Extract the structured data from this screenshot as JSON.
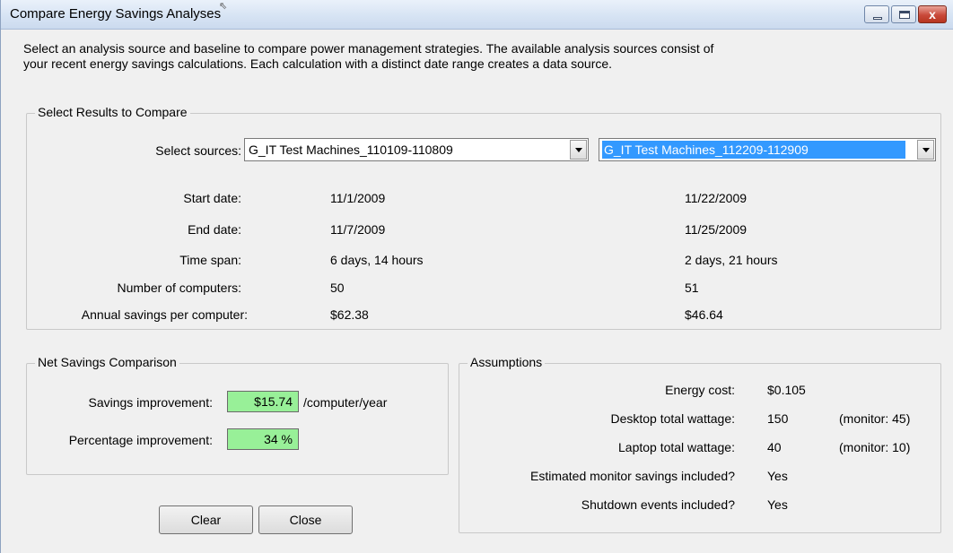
{
  "window": {
    "title": "Compare Energy Savings Analyses",
    "close_glyph": "x",
    "icons": [
      "minimize-icon",
      "maximize-icon",
      "close-icon"
    ]
  },
  "intro": {
    "line1": "Select an analysis source and baseline to compare power management strategies.  The available analysis sources consist of",
    "line2": "your recent energy savings calculations. Each calculation with a distinct date range creates a data source."
  },
  "results": {
    "legend": "Select Results to Compare",
    "select_label": "Select sources:",
    "source1": "G_IT Test Machines_110109-110809",
    "source2": "G_IT Test Machines_112209-112909",
    "rows": [
      {
        "label": "Start date:",
        "v1": "11/1/2009",
        "v2": "11/22/2009"
      },
      {
        "label": "End date:",
        "v1": "11/7/2009",
        "v2": "11/25/2009"
      },
      {
        "label": "Time span:",
        "v1": "6 days, 14 hours",
        "v2": "2 days, 21 hours"
      },
      {
        "label": "Number of computers:",
        "v1": "50",
        "v2": "51"
      },
      {
        "label": "Annual savings per computer:",
        "v1": "$62.38",
        "v2": "$46.64"
      }
    ]
  },
  "net": {
    "legend": "Net Savings Comparison",
    "savings_label": "Savings  improvement:",
    "savings_value": "$15.74",
    "savings_unit": "/computer/year",
    "pct_label": "Percentage improvement:",
    "pct_value": "34 %"
  },
  "buttons": {
    "clear": "Clear",
    "close": "Close"
  },
  "assumptions": {
    "legend": "Assumptions",
    "rows": [
      {
        "label": "Energy cost:",
        "value": "$0.105",
        "extra": ""
      },
      {
        "label": "Desktop total wattage:",
        "value": "150",
        "extra": "(monitor: 45)"
      },
      {
        "label": "Laptop total wattage:",
        "value": "40",
        "extra": "(monitor: 10)"
      },
      {
        "label": "Estimated monitor savings included?",
        "value": "Yes",
        "extra": ""
      },
      {
        "label": "Shutdown events included?",
        "value": "Yes",
        "extra": ""
      }
    ]
  },
  "colors": {
    "highlight_box": "#98f098",
    "selection": "#3399ff"
  }
}
